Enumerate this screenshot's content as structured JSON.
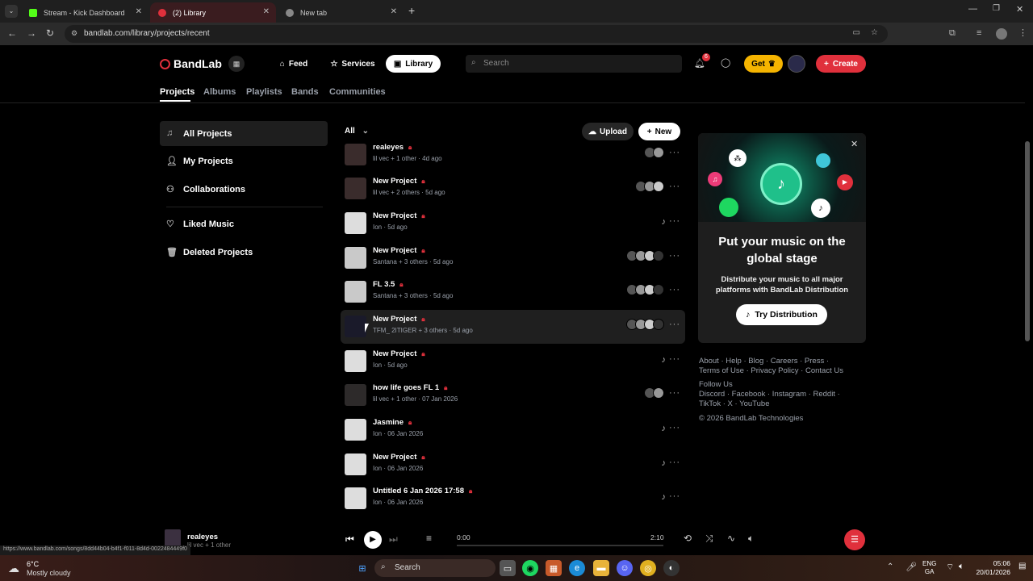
{
  "browser": {
    "tabs": [
      {
        "label": "Stream - Kick Dashboard"
      },
      {
        "label": "(2) Library"
      },
      {
        "label": "New tab"
      }
    ],
    "url": "bandlab.com/library/projects/recent"
  },
  "header": {
    "logo": "BandLab",
    "nav": {
      "feed": "Feed",
      "services": "Services",
      "library": "Library"
    },
    "search_placeholder": "Search",
    "notif_count": "6",
    "get_label": "Get",
    "create_label": "Create"
  },
  "subtabs": [
    "Projects",
    "Albums",
    "Playlists",
    "Bands",
    "Communities"
  ],
  "sidebar": {
    "items": [
      {
        "label": "All Projects"
      },
      {
        "label": "My Projects"
      },
      {
        "label": "Collaborations"
      },
      {
        "label": "Liked Music"
      },
      {
        "label": "Deleted Projects"
      }
    ]
  },
  "list_controls": {
    "filter": "All",
    "upload": "Upload",
    "new": "New"
  },
  "projects": [
    {
      "title": "realeyes",
      "owner": "lil vec + 1 other",
      "time": "4d ago"
    },
    {
      "title": "New Project",
      "owner": "lil vec + 2 others",
      "time": "5d ago"
    },
    {
      "title": "New Project",
      "owner": "Ion",
      "time": "5d ago"
    },
    {
      "title": "New Project",
      "owner": "Santana + 3 others",
      "time": "5d ago"
    },
    {
      "title": "FL 3.5",
      "owner": "Santana + 3 others",
      "time": "5d ago"
    },
    {
      "title": "New Project",
      "owner": "TFM_ 2ITIGER + 3 others",
      "time": "5d ago"
    },
    {
      "title": "New Project",
      "owner": "Ion",
      "time": "5d ago"
    },
    {
      "title": "how life goes FL 1",
      "owner": "lil vec + 1 other",
      "time": "07 Jan 2026"
    },
    {
      "title": "Jasmine",
      "owner": "Ion",
      "time": "06 Jan 2026"
    },
    {
      "title": "New Project",
      "owner": "Ion",
      "time": "06 Jan 2026"
    },
    {
      "title": "Untitled 6 Jan 2026 17:58",
      "owner": "Ion",
      "time": "06 Jan 2026"
    }
  ],
  "promo": {
    "title": "Put your music on the global stage",
    "body": "Distribute your music to all major platforms with BandLab Distribution",
    "cta": "Try Distribution"
  },
  "footer": {
    "line1": "About · Help · Blog · Careers · Press ·",
    "line2": "Terms of Use · Privacy Policy · Contact Us",
    "follow": "Follow Us",
    "line3": "Discord · Facebook · Instagram · Reddit ·",
    "line4": "TikTok · X · YouTube",
    "copyright": "© 2026 BandLab Technologies"
  },
  "player": {
    "title": "realeyes",
    "artist": "lil vec + 1 other",
    "current": "0:00",
    "duration": "2:10",
    "status_url": "https://www.bandlab.com/songs/8dd44b04-b4f1-f011-8d4d-0022484449f0"
  },
  "taskbar": {
    "weather_temp": "6°C",
    "weather_desc": "Mostly cloudy",
    "search": "Search",
    "lang1": "ENG",
    "lang2": "GA",
    "time": "05:06",
    "date": "20/01/2026"
  },
  "colors": {
    "accent_red": "#e0303c",
    "gold": "#f5b400",
    "teal": "#1fc08a"
  }
}
